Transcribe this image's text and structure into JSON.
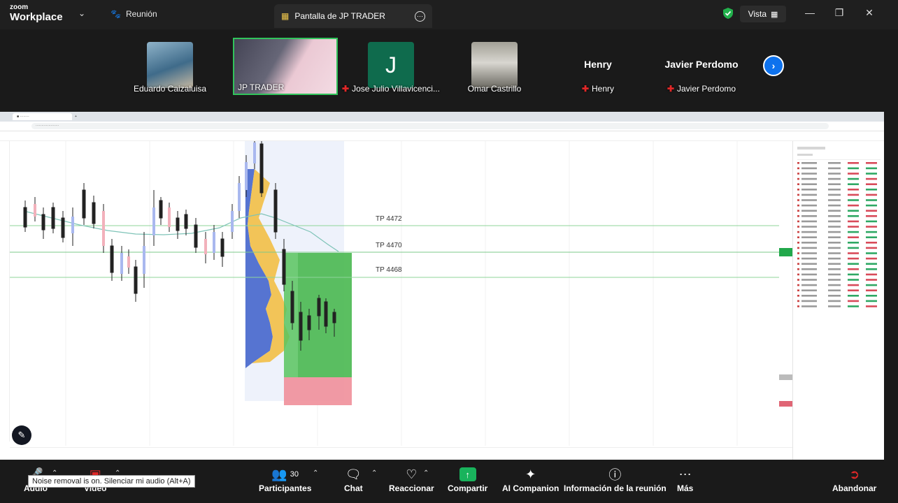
{
  "app": {
    "logo_line1": "zoom",
    "logo_line2": "Workplace",
    "meeting_label": "Reunión",
    "share_tab_label": "Pantalla de JP TRADER",
    "view_label": "Vista"
  },
  "participants": [
    {
      "name": "Eduardo Caizaluisa",
      "muted": false
    },
    {
      "name": "JP TRADER",
      "muted": false,
      "active": true
    },
    {
      "name": "Jose Julio Villavicenci...",
      "muted": true,
      "initial": "J"
    },
    {
      "name": "Omar Castrillo",
      "muted": false
    },
    {
      "name": "Henry",
      "muted": true,
      "big_name": "Henry"
    },
    {
      "name": "Javier Perdomo",
      "muted": true,
      "big_name": "Javier Perdomo"
    }
  ],
  "chart": {
    "tp_labels": [
      "TP 4472",
      "TP 4470",
      "TP 4468"
    ]
  },
  "toolbar": {
    "audio": "Audio",
    "video": "Video",
    "participants": "Participantes",
    "participants_count": "30",
    "chat": "Chat",
    "react": "Reaccionar",
    "share": "Compartir",
    "ai": "AI Companion",
    "info": "Información de la reunión",
    "more": "Más",
    "leave": "Abandonar",
    "tooltip": "Noise removal is on. Silenciar mi audio (Alt+A)"
  },
  "colors": {
    "accent_blue": "#0e72ed",
    "share_green": "#19b35c",
    "active_border": "#31c45b",
    "leave_red": "#e02828"
  }
}
